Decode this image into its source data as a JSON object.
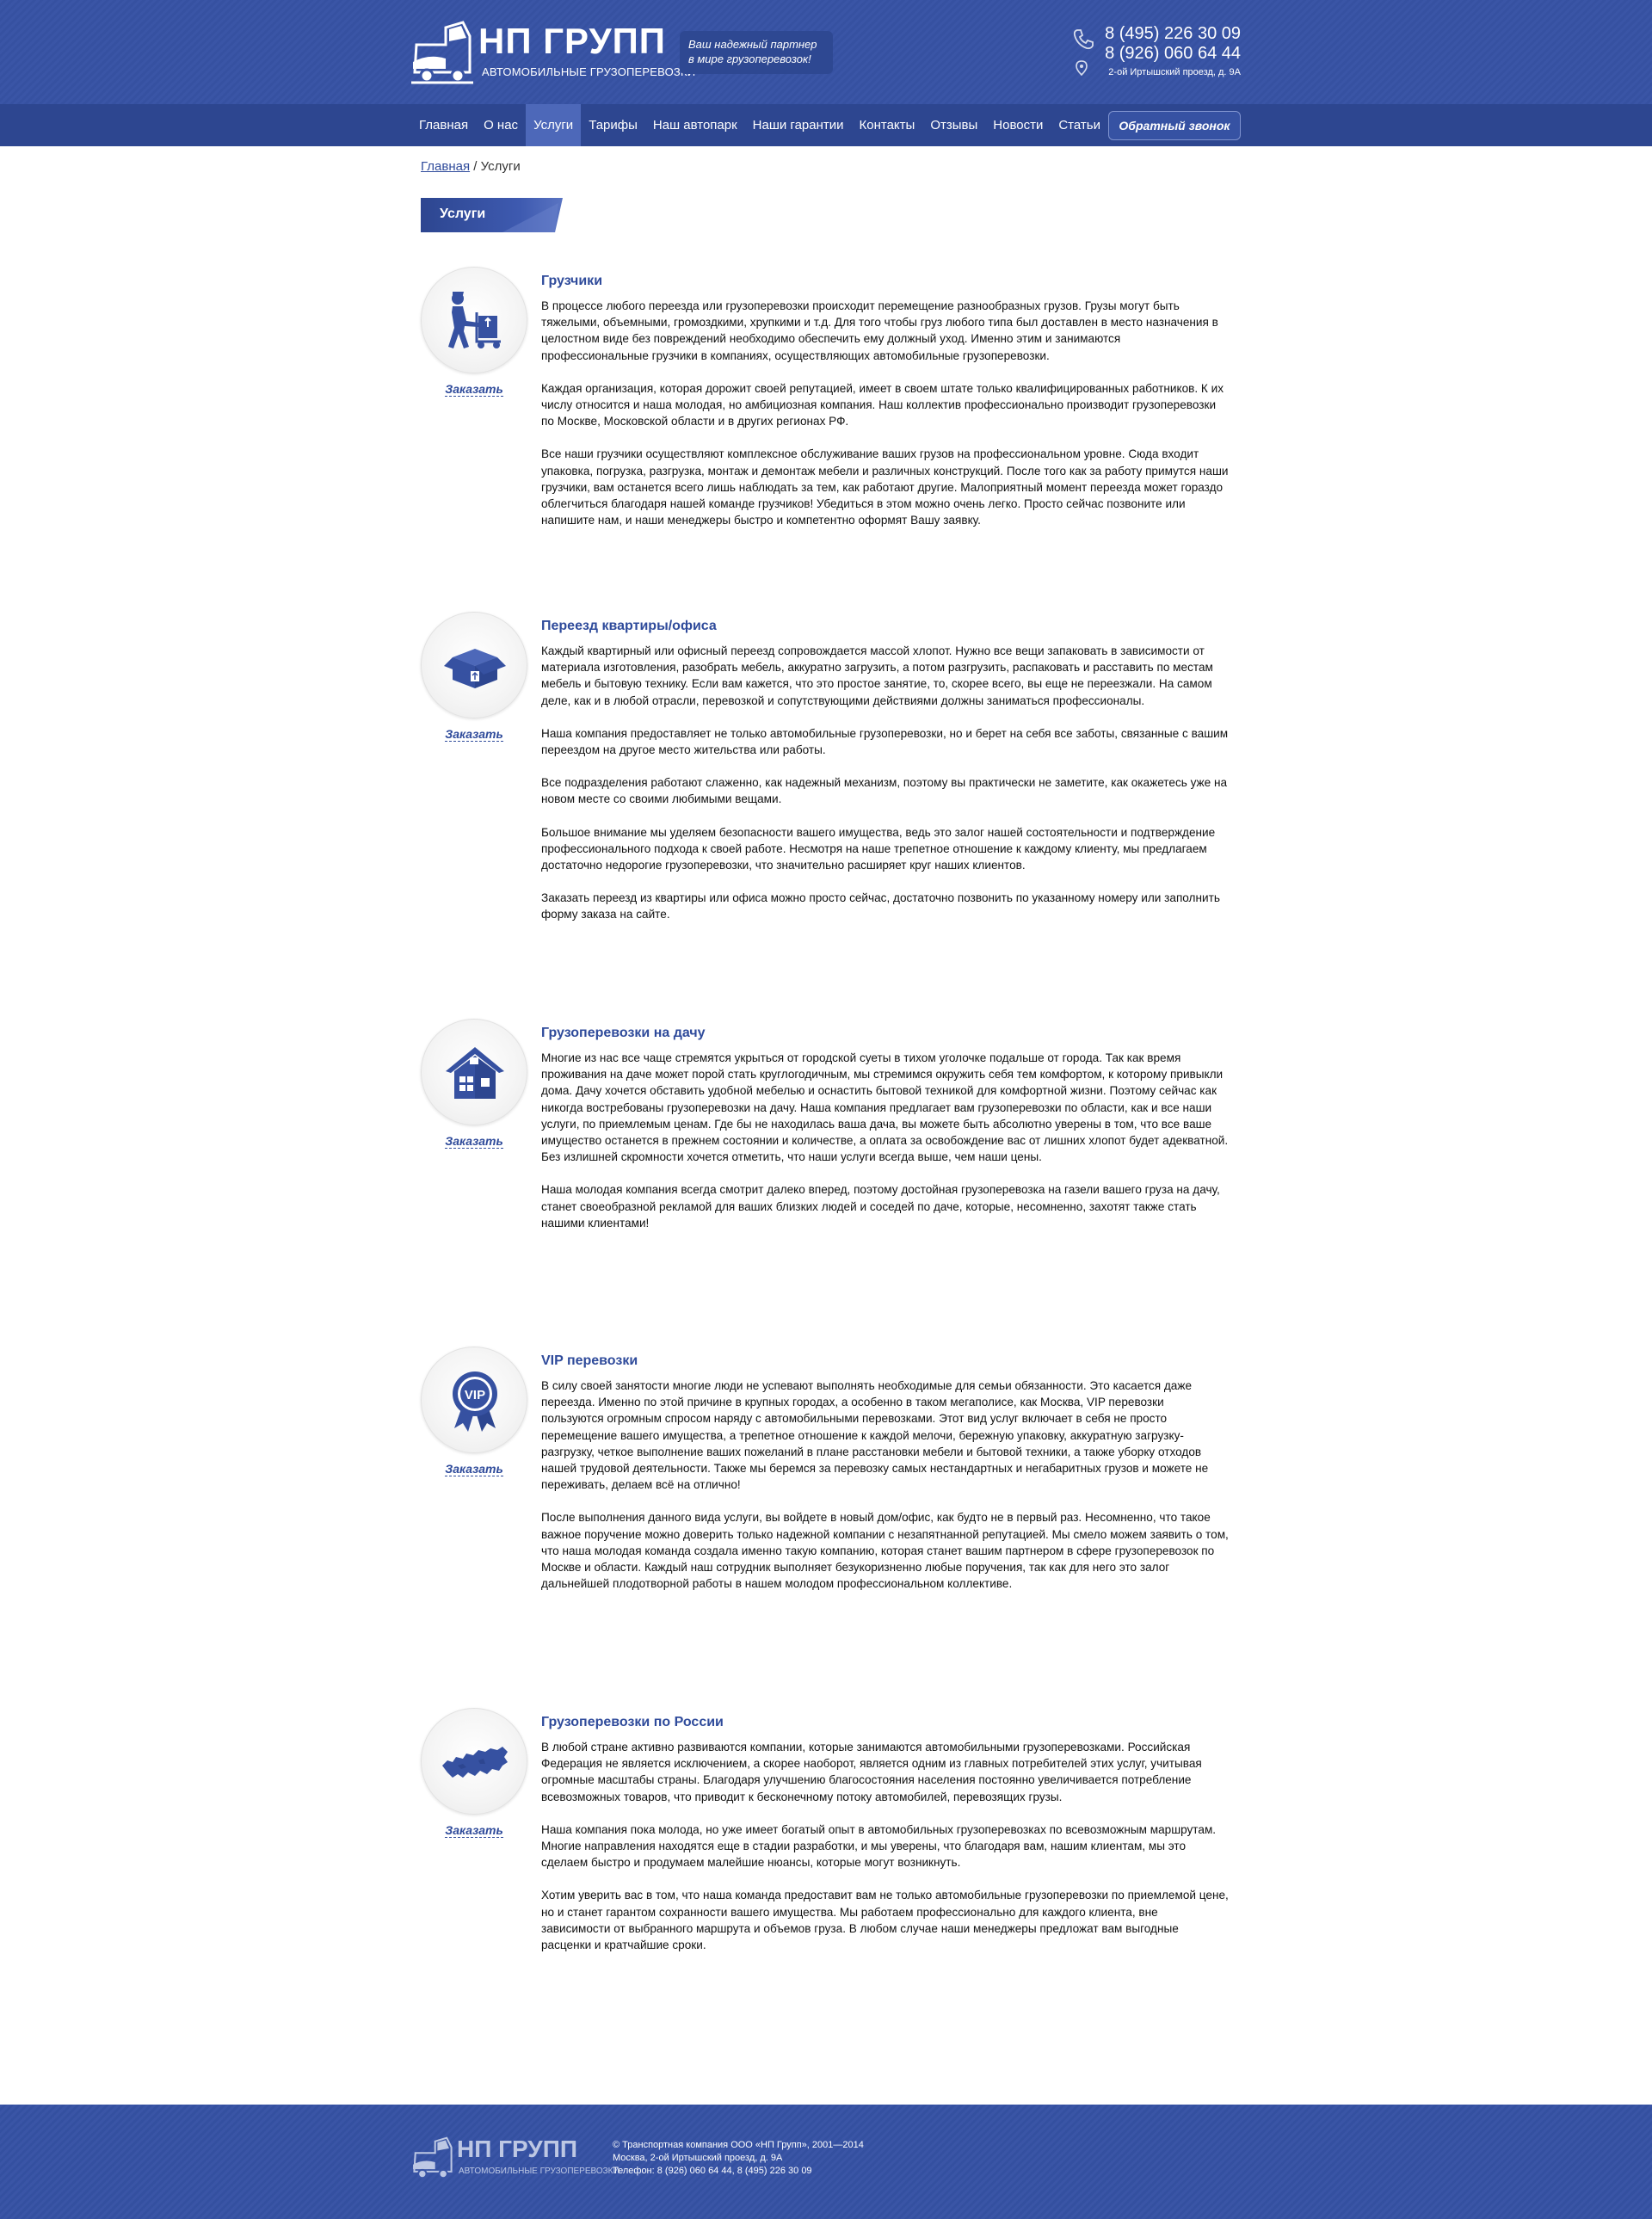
{
  "header": {
    "logo_title": "НП ГРУПП",
    "logo_subtitle": "АВТОМОБИЛЬНЫЕ ГРУЗОПЕРЕВОЗКИ",
    "slogan_line1": "Ваш надежный партнер",
    "slogan_line2": "в мире грузоперевозок!",
    "phone1": "8 (495) 226 30 09",
    "phone2": "8 (926) 060 64 44",
    "address": "2-ой Иртышский проезд, д. 9А"
  },
  "nav": {
    "items": [
      "Главная",
      "О нас",
      "Услуги",
      "Тарифы",
      "Наш автопарк",
      "Наши гарантии",
      "Контакты",
      "Отзывы",
      "Новости",
      "Статьи"
    ],
    "active": "Услуги",
    "callback_label": "Обратный звонок"
  },
  "breadcrumb": {
    "home": "Главная",
    "separator": " / ",
    "current": "Услуги"
  },
  "page_title": "Услуги",
  "order_label": "Заказать",
  "services": [
    {
      "icon": "mover-icon",
      "title": "Грузчики",
      "paragraphs": [
        " В процессе любого переезда или грузоперевозки происходит перемещение разнообразных грузов. Грузы могут быть тяжелыми, объемными, громоздкими, хрупкими и т.д. Для того чтобы груз любого типа был доставлен в место назначения в целостном виде без повреждений необходимо обеспечить ему должный уход. Именно этим и занимаются профессиональные грузчики в компаниях, осуществляющих автомобильные грузоперевозки.",
        "Каждая организация, которая дорожит своей репутацией, имеет в своем штате только квалифицированных работников. К их числу относится и наша молодая, но амбициозная компания. Наш коллектив профессионально производит грузоперевозки по Москве, Московской области и в других регионах РФ.",
        "Все наши грузчики осуществляют комплексное обслуживание ваших грузов на профессиональном уровне. Сюда входит упаковка, погрузка, разгрузка, монтаж и демонтаж мебели и различных конструкций. После того как за работу примутся наши грузчики, вам останется всего лишь наблюдать за тем, как работают другие. Малоприятный момент переезда может гораздо облегчиться благодаря нашей команде грузчиков! Убедиться в этом можно очень легко. Просто сейчас позвоните или напишите нам, и наши менеджеры быстро и компетентно оформят Вашу заявку."
      ]
    },
    {
      "icon": "box-icon",
      "title": "Переезд квартиры/офиса",
      "paragraphs": [
        "Каждый квартирный или офисный переезд сопровождается массой хлопот. Нужно все вещи запаковать в зависимости от материала изготовления, разобрать мебель, аккуратно загрузить, а потом разгрузить, распаковать и расставить по местам мебель и бытовую технику. Если вам кажется, что это простое занятие, то, скорее всего, вы еще не переезжали. На самом деле, как и в любой отрасли, перевозкой и сопутствующими действиями должны заниматься профессионалы.",
        "Наша компания предоставляет не только автомобильные грузоперевозки, но и берет на себя все заботы, связанные с вашим переездом на другое место жительства или работы.",
        "Все подразделения работают слаженно, как надежный механизм, поэтому вы практически не заметите, как окажетесь уже на новом месте со своими любимыми вещами.",
        "Большое внимание мы уделяем безопасности вашего имущества, ведь это залог нашей состоятельности и подтверждение профессионального подхода к своей работе. Несмотря на наше трепетное отношение к каждому клиенту, мы предлагаем достаточно недорогие грузоперевозки, что значительно расширяет круг наших клиентов.",
        "Заказать переезд из квартиры или офиса можно просто сейчас, достаточно позвонить по указанному номеру или заполнить форму заказа на сайте."
      ]
    },
    {
      "icon": "house-icon",
      "title": "Грузоперевозки на дачу",
      "paragraphs": [
        " Многие из нас все чаще стремятся укрыться от городской суеты в тихом уголочке подальше от города. Так как время проживания на даче может порой стать круглогодичным, мы стремимся окружить себя тем комфортом, к которому привыкли дома. Дачу хочется обставить удобной мебелью и оснастить бытовой техникой для комфортной жизни. Поэтому сейчас как никогда востребованы грузоперевозки на дачу. Наша компания предлагает вам грузоперевозки по области, как и все наши услуги, по приемлемым ценам. Где бы не находилась ваша дача, вы можете быть абсолютно уверены в том, что все ваше имущество останется в прежнем состоянии и количестве, а оплата за освобождение вас от лишних хлопот будет адекватной. Без излишней скромности хочется отметить, что наши услуги всегда выше, чем наши цены.",
        "Наша молодая компания всегда смотрит далеко вперед, поэтому достойная грузоперевозка на газели вашего груза на дачу, станет своеобразной рекламой для ваших близких людей и соседей по даче, которые, несомненно, захотят также стать нашими клиентами!"
      ]
    },
    {
      "icon": "vip-badge-icon",
      "icon_text": "VIP",
      "title": "VIP перевозки",
      "paragraphs": [
        "В силу своей занятости многие люди не успевают выполнять необходимые для семьи обязанности. Это касается даже переезда. Именно по этой причине в крупных городах, а особенно в таком мегаполисе, как Москва, VIP перевозки пользуются огромным спросом наряду с автомобильными перевозками. Этот вид услуг включает в себя не просто перемещение вашего имущества, а трепетное отношение к каждой мелочи, бережную упаковку, аккуратную загрузку-разгрузку, четкое выполнение ваших пожеланий в плане расстановки мебели и бытовой техники, а также уборку отходов нашей трудовой деятельности. Также мы беремся за перевозку самых нестандартных и негабаритных грузов и можете не переживать, делаем всё на отлично!",
        "После выполнения данного вида услуги, вы войдете в новый дом/офис, как будто не в первый раз. Несомненно, что такое важное поручение можно доверить только надежной компании с незапятнанной репутацией. Мы смело можем заявить о том, что наша молодая команда создала именно такую компанию, которая станет вашим партнером в сфере грузоперевозок по Москве и области. Каждый наш сотрудник выполняет безукоризненно любые поручения, так как для него это залог дальнейшей плодотворной работы в нашем молодом профессиональном коллективе."
      ]
    },
    {
      "icon": "russia-map-icon",
      "title": "Грузоперевозки по России",
      "paragraphs": [
        " В любой стране активно развиваются компании, которые занимаются автомобильными грузоперевозками. Российская Федерация не является исключением, а скорее наоборот, является одним из главных потребителей этих услуг, учитывая огромные масштабы страны. Благодаря улучшению благосостояния населения постоянно увеличивается потребление всевозможных товаров, что приводит к бесконечному потоку автомобилей, перевозящих грузы.",
        "Наша компания пока молода, но уже имеет богатый опыт в автомобильных грузоперевозках по всевозможным маршрутам. Многие направления находятся еще в стадии разработки, и мы уверены, что благодаря вам, нашим клиентам, мы это сделаем быстро и продумаем малейшие нюансы, которые могут возникнуть.",
        "Хотим уверить вас в том, что наша команда предоставит вам не только автомобильные грузоперевозки по приемлемой цене, но и станет гарантом сохранности вашего имущества. Мы работаем профессионально для каждого клиента, вне зависимости от выбранного маршрута и объемов груза. В любом случае наши менеджеры предложат вам выгодные расценки и кратчайшие сроки."
      ]
    }
  ],
  "footer": {
    "logo_title": "НП ГРУПП",
    "logo_subtitle": "АВТОМОБИЛЬНЫЕ ГРУЗОПЕРЕВОЗКИ",
    "line1": "© Транспортная компания ООО «НП Групп», 2001—2014",
    "line2": "Москва, 2-ой Иртышский проезд, д. 9А",
    "line3": "Телефон: 8 (926) 060 64 44,  8 (495) 226 30 09"
  },
  "colors": {
    "brand_blue": "#3a55a6",
    "nav_blue": "#2d4690",
    "active_tab": "#4d68b9",
    "link_blue": "#2f4b9b"
  }
}
